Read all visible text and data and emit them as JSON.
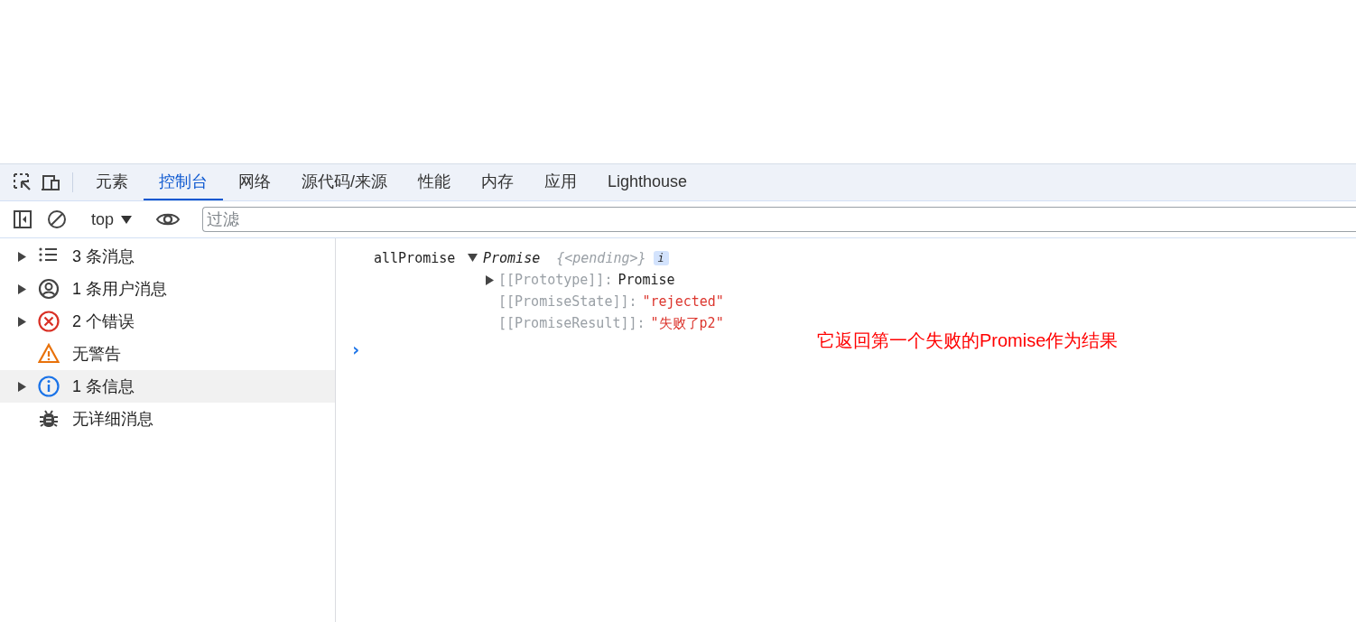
{
  "tabs": [
    {
      "label": "元素",
      "selected": false
    },
    {
      "label": "控制台",
      "selected": true
    },
    {
      "label": "网络",
      "selected": false
    },
    {
      "label": "源代码/来源",
      "selected": false
    },
    {
      "label": "性能",
      "selected": false
    },
    {
      "label": "内存",
      "selected": false
    },
    {
      "label": "应用",
      "selected": false
    },
    {
      "label": "Lighthouse",
      "selected": false
    }
  ],
  "toolbar": {
    "context": "top",
    "filter": {
      "placeholder": "过滤"
    }
  },
  "sidebar": {
    "items": [
      {
        "kind": "messages",
        "label": "3 条消息",
        "expandable": true,
        "selected": false
      },
      {
        "kind": "user",
        "label": "1 条用户消息",
        "expandable": true,
        "selected": false
      },
      {
        "kind": "error",
        "label": "2 个错误",
        "expandable": true,
        "selected": false
      },
      {
        "kind": "warning",
        "label": "无警告",
        "expandable": false,
        "selected": false
      },
      {
        "kind": "info",
        "label": "1 条信息",
        "expandable": true,
        "selected": true
      },
      {
        "kind": "verbose",
        "label": "无详细消息",
        "expandable": false,
        "selected": false
      }
    ]
  },
  "console": {
    "entry": {
      "label": "allPromise",
      "type": "Promise",
      "preview": "{<pending>}",
      "badge": "i",
      "expanded": true,
      "properties": [
        {
          "key": "[[Prototype]]:",
          "value": "Promise",
          "kind": "object",
          "expandable": true
        },
        {
          "key": "[[PromiseState]]:",
          "value": "\"rejected\"",
          "kind": "string",
          "expandable": false
        },
        {
          "key": "[[PromiseResult]]:",
          "value": "\"失败了p2\"",
          "kind": "string",
          "expandable": false
        }
      ]
    },
    "prompt": "›"
  },
  "annotation": "它返回第一个失败的Promise作为结果"
}
